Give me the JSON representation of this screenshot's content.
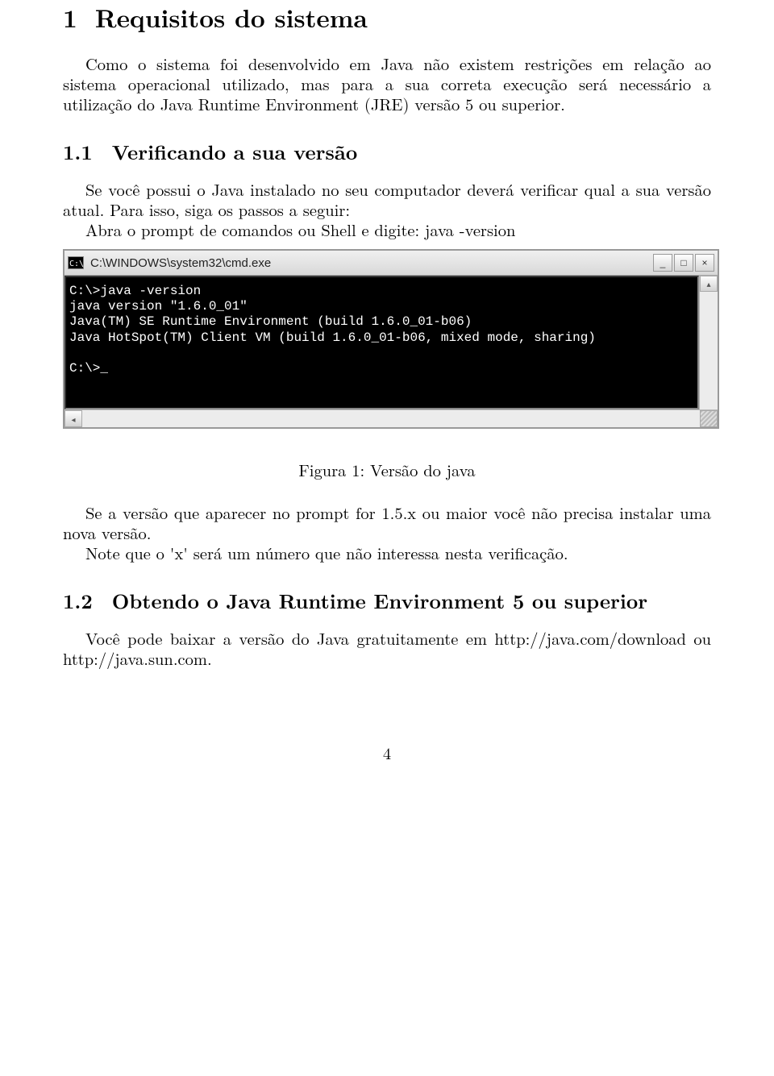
{
  "section1": {
    "number": "1",
    "title": "Requisitos do sistema",
    "para1": "Como o sistema foi desenvolvido em Java não existem restrições em relação ao sistema operacional utilizado, mas para a sua correta execução será necessário a utilização do Java Runtime Environment (JRE) versão 5 ou superior."
  },
  "section11": {
    "number": "1.1",
    "title": "Verificando a sua versão",
    "para1": "Se você possui o Java instalado no seu computador deverá verificar qual a sua versão atual. Para isso, siga os passos a seguir:",
    "para2": "Abra o prompt de comandos ou Shell e digite: java -version"
  },
  "cmd": {
    "titlebar_icon_text": "C:\\",
    "titlebar_text": "C:\\WINDOWS\\system32\\cmd.exe",
    "lines": "C:\\>java -version\njava version \"1.6.0_01\"\nJava(TM) SE Runtime Environment (build 1.6.0_01-b06)\nJava HotSpot(TM) Client VM (build 1.6.0_01-b06, mixed mode, sharing)\n\nC:\\>_"
  },
  "figure": {
    "caption": "Figura 1: Versão do java"
  },
  "after_fig": {
    "para1": "Se a versão que aparecer no prompt for 1.5.x ou maior você não precisa instalar uma nova versão.",
    "para2": "Note que o 'x' será um número que não interessa nesta verificação."
  },
  "section12": {
    "number": "1.2",
    "title": "Obtendo o Java Runtime Environment 5 ou superior",
    "para1": "Você pode baixar a versão do Java gratuitamente em http://java.com/download ou http://java.sun.com."
  },
  "page_number": "4",
  "win_buttons": {
    "min": "_",
    "max": "□",
    "close": "×"
  },
  "scroll_glyphs": {
    "up": "▴",
    "left": "◂"
  }
}
